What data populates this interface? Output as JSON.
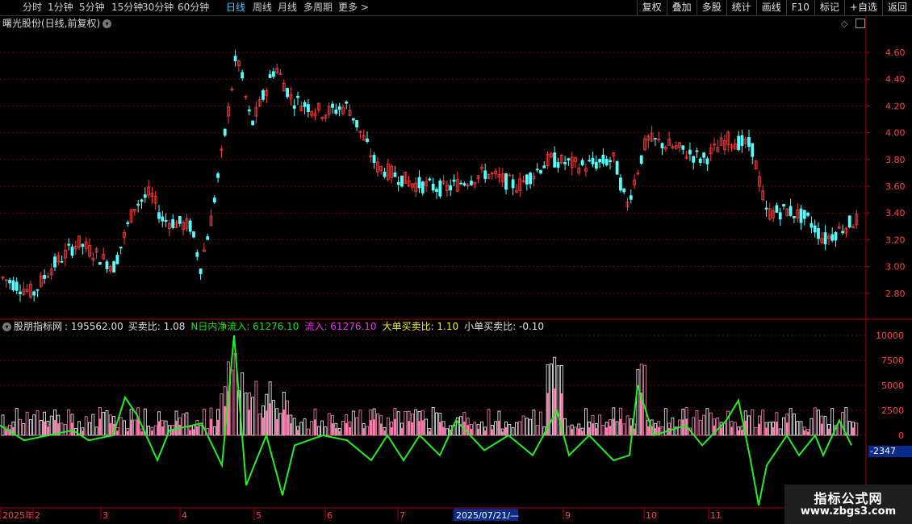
{
  "toolbar": {
    "periods": [
      "分时",
      "1分钟",
      "5分钟",
      "15分钟",
      "30分钟",
      "60分钟",
      "日线",
      "周线",
      "月线",
      "多周期",
      "更多 >"
    ],
    "active_period": "日线",
    "right_buttons": [
      "复权",
      "叠加",
      "多股",
      "统计",
      "画线",
      "F10",
      "标记",
      "+自选",
      "返回"
    ]
  },
  "stock": {
    "name": "曙光股份(日线,前复权)"
  },
  "price_axis": [
    "4.60",
    "4.40",
    "4.20",
    "4.00",
    "3.80",
    "3.60",
    "3.40",
    "3.20",
    "3.00",
    "2.80"
  ],
  "indicator": {
    "name": "股朋指标网",
    "value": ": 195562.00",
    "items": [
      {
        "label": "买卖比: 1.08",
        "color": "#e0e0e0"
      },
      {
        "label": "N日内净流入: 61276.10",
        "color": "#22dd22"
      },
      {
        "label": "流入: 61276.10",
        "color": "#ee33ee"
      },
      {
        "label": "大单买卖比: 1.10",
        "color": "#eeee33"
      },
      {
        "label": "小单买卖比: -0.10",
        "color": "#e0e0e0"
      }
    ],
    "axis": [
      "10000",
      "7500",
      "5000",
      "2500",
      "0"
    ],
    "current_value_label": "-2347"
  },
  "date_axis": [
    "2025年",
    "2",
    "3",
    "4",
    "5",
    "6",
    "7",
    "2025/07/21/—",
    "9",
    "10",
    "11"
  ],
  "watermark": {
    "line1": "指标公式网",
    "line2": "www.zbgs3.com"
  },
  "colors": {
    "up": "#ff3b3b",
    "down": "#54ffff",
    "grid": "#7a0000",
    "axis": "#b00000",
    "text_red": "#ff4444"
  }
}
